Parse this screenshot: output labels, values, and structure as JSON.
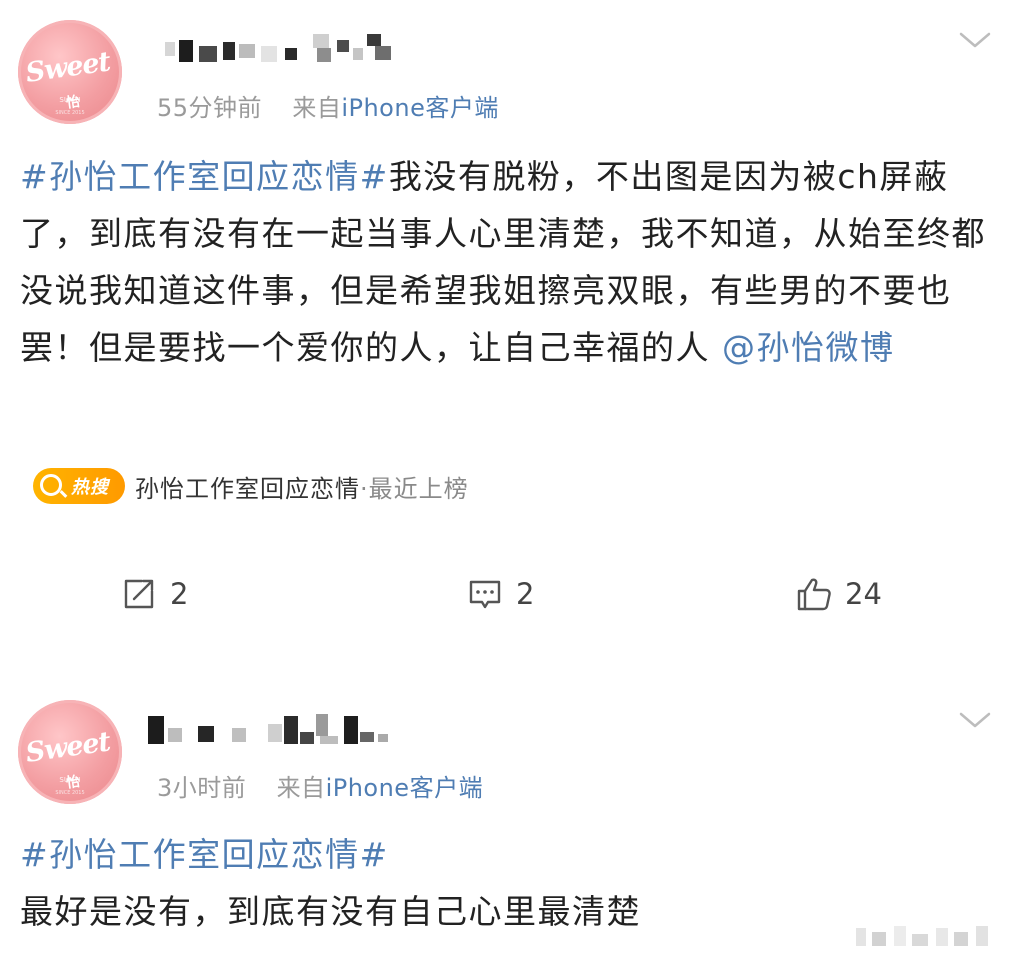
{
  "posts": [
    {
      "time": "55分钟前",
      "source_prefix": "来自",
      "source": "iPhone客户端",
      "avatar_text": "Sweet怡",
      "topic": "#孙怡工作室回应恋情#",
      "body": "我没有脱粉，不出图是因为被ch屏蔽了，到底有没有在一起当事人心里清楚，我不知道，从始至终都没说我知道这件事，但是希望我姐擦亮双眼，有些男的不要也罢！但是要找一个爱你的人，让自己幸福的人",
      "mention": "@孙怡微博",
      "hot_search": {
        "badge": "热搜",
        "text": "孙怡工作室回应恋情",
        "suffix": "·最近上榜"
      },
      "actions": {
        "repost": "2",
        "comment": "2",
        "like": "24"
      }
    },
    {
      "time": "3小时前",
      "source_prefix": "来自",
      "source": "iPhone客户端",
      "avatar_text": "Sweet怡",
      "topic": "#孙怡工作室回应恋情#",
      "body": "最好是没有，到底有没有自己心里最清楚"
    }
  ],
  "icons": {
    "menu": "chevron-down-icon",
    "repost": "repost-icon",
    "comment": "comment-icon",
    "like": "thumbs-up-icon",
    "hot": "search-icon"
  },
  "colors": {
    "link": "#4f7db3",
    "meta": "#9a9a9a",
    "hot_badge": "#ffa800",
    "avatar": "#f39ea2"
  }
}
